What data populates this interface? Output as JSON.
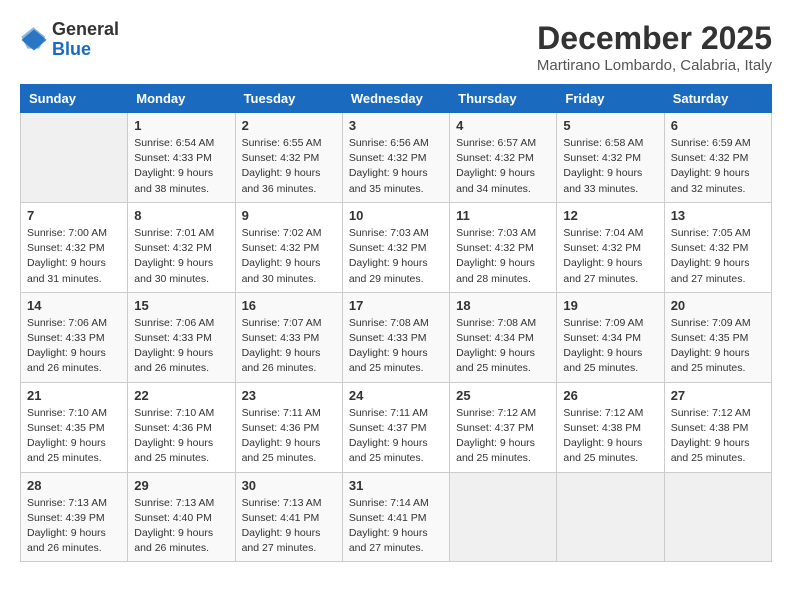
{
  "logo": {
    "general": "General",
    "blue": "Blue"
  },
  "header": {
    "title": "December 2025",
    "subtitle": "Martirano Lombardo, Calabria, Italy"
  },
  "weekdays": [
    "Sunday",
    "Monday",
    "Tuesday",
    "Wednesday",
    "Thursday",
    "Friday",
    "Saturday"
  ],
  "weeks": [
    [
      {
        "day": "",
        "sunrise": "",
        "sunset": "",
        "daylight": ""
      },
      {
        "day": "1",
        "sunrise": "Sunrise: 6:54 AM",
        "sunset": "Sunset: 4:33 PM",
        "daylight": "Daylight: 9 hours and 38 minutes."
      },
      {
        "day": "2",
        "sunrise": "Sunrise: 6:55 AM",
        "sunset": "Sunset: 4:32 PM",
        "daylight": "Daylight: 9 hours and 36 minutes."
      },
      {
        "day": "3",
        "sunrise": "Sunrise: 6:56 AM",
        "sunset": "Sunset: 4:32 PM",
        "daylight": "Daylight: 9 hours and 35 minutes."
      },
      {
        "day": "4",
        "sunrise": "Sunrise: 6:57 AM",
        "sunset": "Sunset: 4:32 PM",
        "daylight": "Daylight: 9 hours and 34 minutes."
      },
      {
        "day": "5",
        "sunrise": "Sunrise: 6:58 AM",
        "sunset": "Sunset: 4:32 PM",
        "daylight": "Daylight: 9 hours and 33 minutes."
      },
      {
        "day": "6",
        "sunrise": "Sunrise: 6:59 AM",
        "sunset": "Sunset: 4:32 PM",
        "daylight": "Daylight: 9 hours and 32 minutes."
      }
    ],
    [
      {
        "day": "7",
        "sunrise": "Sunrise: 7:00 AM",
        "sunset": "Sunset: 4:32 PM",
        "daylight": "Daylight: 9 hours and 31 minutes."
      },
      {
        "day": "8",
        "sunrise": "Sunrise: 7:01 AM",
        "sunset": "Sunset: 4:32 PM",
        "daylight": "Daylight: 9 hours and 30 minutes."
      },
      {
        "day": "9",
        "sunrise": "Sunrise: 7:02 AM",
        "sunset": "Sunset: 4:32 PM",
        "daylight": "Daylight: 9 hours and 30 minutes."
      },
      {
        "day": "10",
        "sunrise": "Sunrise: 7:03 AM",
        "sunset": "Sunset: 4:32 PM",
        "daylight": "Daylight: 9 hours and 29 minutes."
      },
      {
        "day": "11",
        "sunrise": "Sunrise: 7:03 AM",
        "sunset": "Sunset: 4:32 PM",
        "daylight": "Daylight: 9 hours and 28 minutes."
      },
      {
        "day": "12",
        "sunrise": "Sunrise: 7:04 AM",
        "sunset": "Sunset: 4:32 PM",
        "daylight": "Daylight: 9 hours and 27 minutes."
      },
      {
        "day": "13",
        "sunrise": "Sunrise: 7:05 AM",
        "sunset": "Sunset: 4:32 PM",
        "daylight": "Daylight: 9 hours and 27 minutes."
      }
    ],
    [
      {
        "day": "14",
        "sunrise": "Sunrise: 7:06 AM",
        "sunset": "Sunset: 4:33 PM",
        "daylight": "Daylight: 9 hours and 26 minutes."
      },
      {
        "day": "15",
        "sunrise": "Sunrise: 7:06 AM",
        "sunset": "Sunset: 4:33 PM",
        "daylight": "Daylight: 9 hours and 26 minutes."
      },
      {
        "day": "16",
        "sunrise": "Sunrise: 7:07 AM",
        "sunset": "Sunset: 4:33 PM",
        "daylight": "Daylight: 9 hours and 26 minutes."
      },
      {
        "day": "17",
        "sunrise": "Sunrise: 7:08 AM",
        "sunset": "Sunset: 4:33 PM",
        "daylight": "Daylight: 9 hours and 25 minutes."
      },
      {
        "day": "18",
        "sunrise": "Sunrise: 7:08 AM",
        "sunset": "Sunset: 4:34 PM",
        "daylight": "Daylight: 9 hours and 25 minutes."
      },
      {
        "day": "19",
        "sunrise": "Sunrise: 7:09 AM",
        "sunset": "Sunset: 4:34 PM",
        "daylight": "Daylight: 9 hours and 25 minutes."
      },
      {
        "day": "20",
        "sunrise": "Sunrise: 7:09 AM",
        "sunset": "Sunset: 4:35 PM",
        "daylight": "Daylight: 9 hours and 25 minutes."
      }
    ],
    [
      {
        "day": "21",
        "sunrise": "Sunrise: 7:10 AM",
        "sunset": "Sunset: 4:35 PM",
        "daylight": "Daylight: 9 hours and 25 minutes."
      },
      {
        "day": "22",
        "sunrise": "Sunrise: 7:10 AM",
        "sunset": "Sunset: 4:36 PM",
        "daylight": "Daylight: 9 hours and 25 minutes."
      },
      {
        "day": "23",
        "sunrise": "Sunrise: 7:11 AM",
        "sunset": "Sunset: 4:36 PM",
        "daylight": "Daylight: 9 hours and 25 minutes."
      },
      {
        "day": "24",
        "sunrise": "Sunrise: 7:11 AM",
        "sunset": "Sunset: 4:37 PM",
        "daylight": "Daylight: 9 hours and 25 minutes."
      },
      {
        "day": "25",
        "sunrise": "Sunrise: 7:12 AM",
        "sunset": "Sunset: 4:37 PM",
        "daylight": "Daylight: 9 hours and 25 minutes."
      },
      {
        "day": "26",
        "sunrise": "Sunrise: 7:12 AM",
        "sunset": "Sunset: 4:38 PM",
        "daylight": "Daylight: 9 hours and 25 minutes."
      },
      {
        "day": "27",
        "sunrise": "Sunrise: 7:12 AM",
        "sunset": "Sunset: 4:38 PM",
        "daylight": "Daylight: 9 hours and 25 minutes."
      }
    ],
    [
      {
        "day": "28",
        "sunrise": "Sunrise: 7:13 AM",
        "sunset": "Sunset: 4:39 PM",
        "daylight": "Daylight: 9 hours and 26 minutes."
      },
      {
        "day": "29",
        "sunrise": "Sunrise: 7:13 AM",
        "sunset": "Sunset: 4:40 PM",
        "daylight": "Daylight: 9 hours and 26 minutes."
      },
      {
        "day": "30",
        "sunrise": "Sunrise: 7:13 AM",
        "sunset": "Sunset: 4:41 PM",
        "daylight": "Daylight: 9 hours and 27 minutes."
      },
      {
        "day": "31",
        "sunrise": "Sunrise: 7:14 AM",
        "sunset": "Sunset: 4:41 PM",
        "daylight": "Daylight: 9 hours and 27 minutes."
      },
      {
        "day": "",
        "sunrise": "",
        "sunset": "",
        "daylight": ""
      },
      {
        "day": "",
        "sunrise": "",
        "sunset": "",
        "daylight": ""
      },
      {
        "day": "",
        "sunrise": "",
        "sunset": "",
        "daylight": ""
      }
    ]
  ]
}
